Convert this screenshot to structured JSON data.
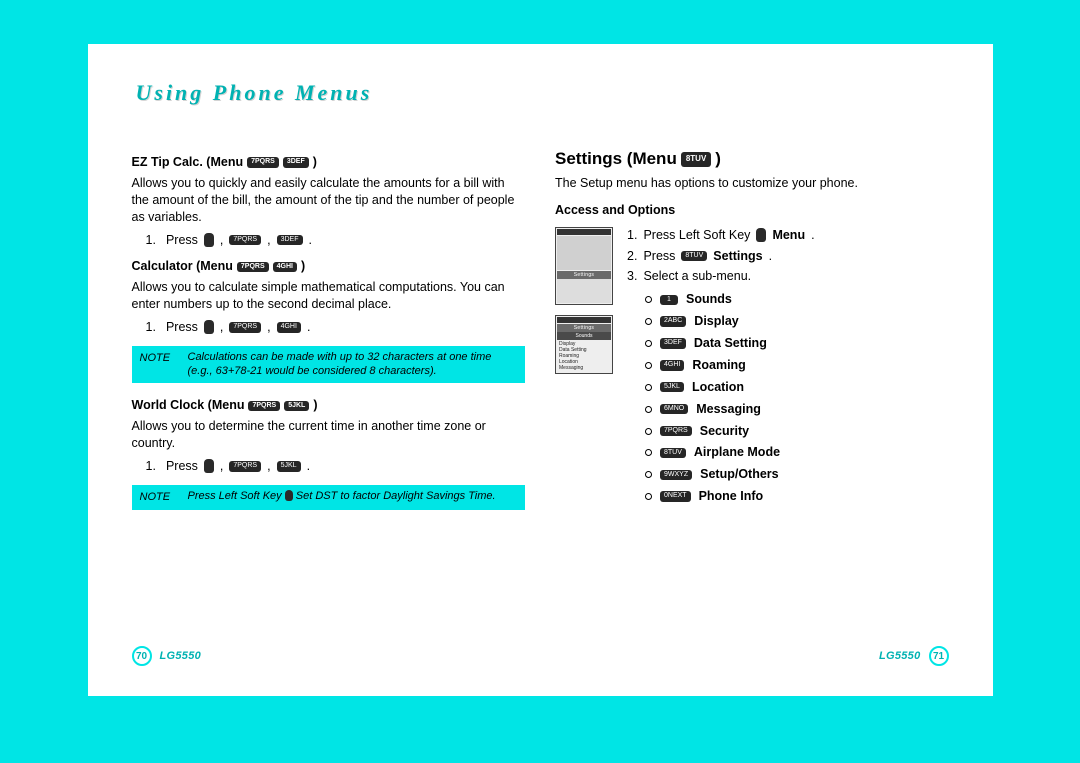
{
  "header": {
    "title": "Using Phone Menus"
  },
  "left": {
    "ez_tip": {
      "title": "EZ Tip Calc. (Menu",
      "key1": "7PQRS",
      "key2": "3DEF",
      "close": ")",
      "desc": "Allows you to quickly and easily calculate the amounts for a bill with the amount of the bill, the amount of the tip and the number of people as variables.",
      "step_num": "1.",
      "step_press": "Press",
      "punct": ",",
      "period": "."
    },
    "calc": {
      "title": "Calculator (Menu",
      "key1": "7PQRS",
      "key2": "4GHI",
      "close": ")",
      "desc": "Allows you to calculate simple mathematical computations. You can enter numbers up to the second decimal place.",
      "step_num": "1.",
      "step_press": "Press",
      "punct": ",",
      "period": ".",
      "note_label": "NOTE",
      "note_body": "Calculations can be made with up to 32 characters at one time (e.g., 63+78-21 would be considered 8 characters)."
    },
    "world": {
      "title": "World Clock (Menu",
      "key1": "7PQRS",
      "key2": "5JKL",
      "close": ")",
      "desc": "Allows you to determine the current time in another time zone or country.",
      "step_num": "1.",
      "step_press": "Press",
      "punct": ",",
      "period": ".",
      "note_label": "NOTE",
      "note_pre": "Press Left Soft Key",
      "note_post": "Set DST to factor Daylight Savings Time."
    }
  },
  "right": {
    "title": "Settings (Menu",
    "key": "8TUV",
    "close": ")",
    "desc": "The Setup menu has options to customize your phone.",
    "access_title": "Access and Options",
    "screen1_label": "Settings",
    "screen2_label": "Settings",
    "screen2_head": "Sounds",
    "screen2_items": [
      "Display",
      "Data Setting",
      "Roaming",
      "Location",
      "Messaging"
    ],
    "steps": {
      "s1_num": "1.",
      "s1_a": "Press Left Soft Key",
      "s1_b": "Menu",
      "s1_p": ".",
      "s2_num": "2.",
      "s2_a": "Press",
      "s2_key": "8TUV",
      "s2_b": "Settings",
      "s2_p": ".",
      "s3_num": "3.",
      "s3_a": "Select a sub-menu.",
      "items": [
        {
          "key": "1",
          "label": "Sounds"
        },
        {
          "key": "2ABC",
          "label": "Display"
        },
        {
          "key": "3DEF",
          "label": "Data Setting"
        },
        {
          "key": "4GHI",
          "label": "Roaming"
        },
        {
          "key": "5JKL",
          "label": "Location"
        },
        {
          "key": "6MNO",
          "label": "Messaging"
        },
        {
          "key": "7PQRS",
          "label": "Security"
        },
        {
          "key": "8TUV",
          "label": "Airplane Mode"
        },
        {
          "key": "9WXYZ",
          "label": "Setup/Others"
        },
        {
          "key": "0NEXT",
          "label": "Phone Info"
        }
      ]
    }
  },
  "footer": {
    "left_page": "70",
    "right_page": "71",
    "model": "LG5550"
  }
}
